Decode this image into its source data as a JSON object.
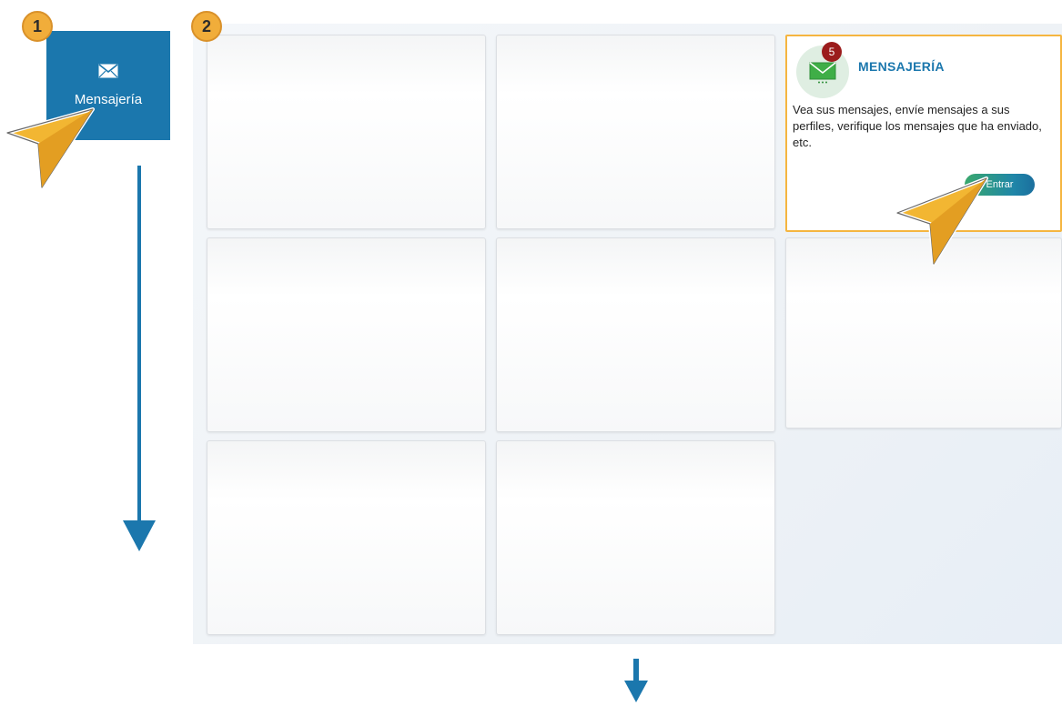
{
  "steps": {
    "one": "1",
    "two": "2"
  },
  "menu_tile": {
    "label": "Mensajería",
    "icon": "envelope-icon"
  },
  "cards": {
    "messaging": {
      "title": "MENSAJERÍA",
      "unread_count": "5",
      "description": "Vea sus mensajes, envíe mensajes a sus perfiles, verifique los mensajes que ha enviado, etc.",
      "enter_label": "Entrar"
    }
  },
  "colors": {
    "primary_blue": "#1b77ad",
    "highlight_orange": "#f5b540",
    "badge_red": "#9b1c1c",
    "pointer_yellow": "#f2b632"
  }
}
